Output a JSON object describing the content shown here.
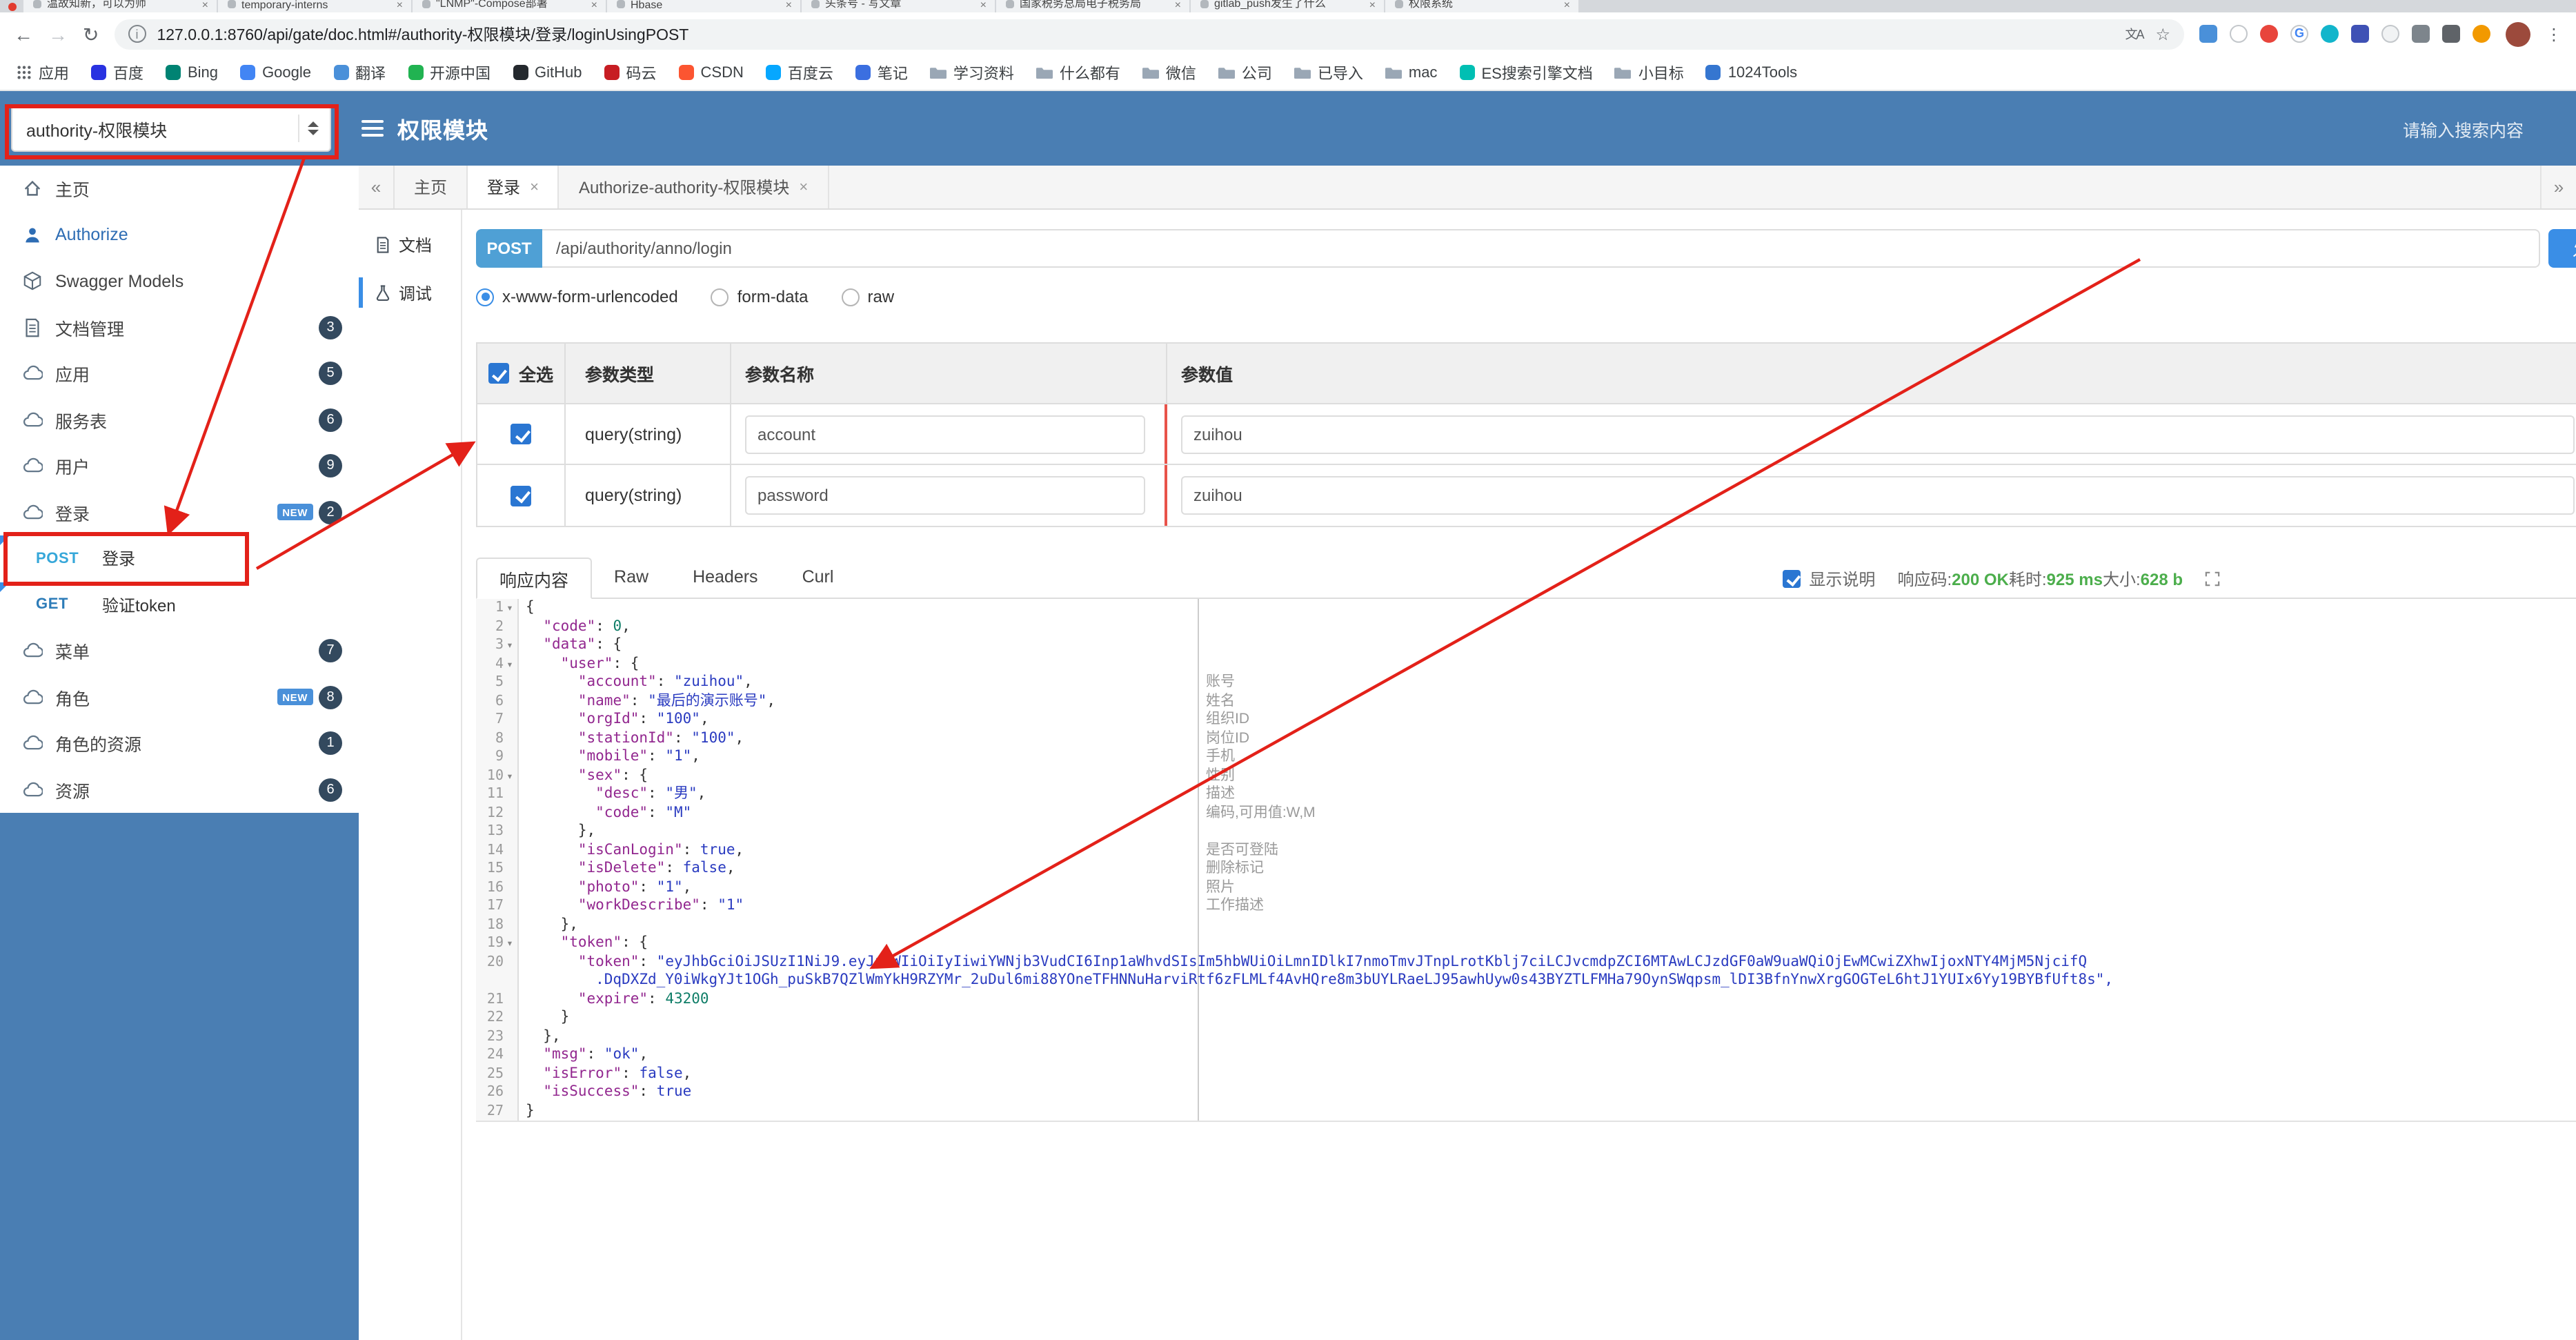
{
  "colors": {
    "header_blue": "#4a7eb3",
    "accent_blue": "#3a8ee6",
    "post_badge_blue": "#4fa0d5",
    "annotation_red": "#e32119",
    "success_green": "#4cae4c",
    "badge_navy": "#33495e"
  },
  "browser": {
    "tabs": [
      "温故知新，可以为师",
      "temporary-interns",
      "\"LNMP\"-Compose部署",
      "Hbase",
      "头条号 - 写文章",
      "国家税务总局电子税务局",
      "gitlab_push发生了什么",
      "权限系统"
    ],
    "url": "127.0.0.1:8760/api/gate/doc.html#/authority-权限模块/登录/loginUsingPOST",
    "extensions": [
      {
        "color": "#4a90d9"
      },
      {
        "color": "#ffffff",
        "round": true,
        "ring": true
      },
      {
        "color": "#e8453c",
        "round": true
      },
      {
        "letter": "G",
        "color": "#ffffff",
        "round": true,
        "ring": true
      },
      {
        "color": "#12b5cb",
        "round": true
      },
      {
        "color": "#3f51b5"
      },
      {
        "color": "#f1f3f4",
        "round": true,
        "ring": true
      },
      {
        "color": "#7d858c"
      },
      {
        "color": "#5f6368"
      },
      {
        "color": "#f29900",
        "round": true
      }
    ],
    "bookmarks": [
      {
        "label": "应用",
        "apps": true
      },
      {
        "label": "百度",
        "color": "#2932e1"
      },
      {
        "label": "Bing",
        "color": "#008373"
      },
      {
        "label": "Google",
        "color": "#4285f4"
      },
      {
        "label": "翻译",
        "color": "#4a90d9"
      },
      {
        "label": "开源中国",
        "color": "#21b351"
      },
      {
        "label": "GitHub",
        "color": "#24292e"
      },
      {
        "label": "码云",
        "color": "#c71d23"
      },
      {
        "label": "CSDN",
        "color": "#fc5531"
      },
      {
        "label": "百度云",
        "color": "#06a7ff"
      },
      {
        "label": "笔记",
        "color": "#3b6fe0"
      },
      {
        "label": "学习资料",
        "folder": true
      },
      {
        "label": "什么都有",
        "folder": true
      },
      {
        "label": "微信",
        "folder": true
      },
      {
        "label": "公司",
        "folder": true
      },
      {
        "label": "已导入",
        "folder": true
      },
      {
        "label": "mac",
        "folder": true
      },
      {
        "label": "ES搜索引擎文档",
        "color": "#00bfb3"
      },
      {
        "label": "小目标",
        "folder": true
      },
      {
        "label": "1024Tools",
        "color": "#3576d0"
      }
    ]
  },
  "header": {
    "module_select": "authority-权限模块",
    "title": "权限模块",
    "search_placeholder": "请输入搜索内容"
  },
  "sidebar": {
    "new_label": "NEW",
    "items": [
      {
        "label": "主页"
      },
      {
        "label": "Authorize"
      },
      {
        "label": "Swagger Models"
      },
      {
        "label": "文档管理",
        "badge": "3"
      },
      {
        "label": "应用",
        "badge": "5"
      },
      {
        "label": "服务表",
        "badge": "6"
      },
      {
        "label": "用户",
        "badge": "9"
      },
      {
        "label": "登录",
        "badge": "2",
        "new": true
      },
      {
        "method": "POST",
        "label": "登录"
      },
      {
        "method": "GET",
        "label": "验证token"
      },
      {
        "label": "菜单",
        "badge": "7"
      },
      {
        "label": "角色",
        "badge": "8",
        "new": true
      },
      {
        "label": "角色的资源",
        "badge": "1"
      },
      {
        "label": "资源",
        "badge": "6"
      }
    ]
  },
  "main": {
    "tabs": [
      {
        "label": "主页"
      },
      {
        "label": "登录"
      },
      {
        "label": "Authorize-authority-权限模块"
      }
    ],
    "doc_tabs": [
      {
        "label": "文档"
      },
      {
        "label": "调试"
      }
    ]
  },
  "request": {
    "method": "POST",
    "url": "/api/authority/anno/login",
    "send_label": "发送",
    "content_types": [
      "x-www-form-urlencoded",
      "form-data",
      "raw"
    ],
    "params": {
      "headers": {
        "all": "全选",
        "type": "参数类型",
        "name": "参数名称",
        "value": "参数值"
      },
      "rows": [
        {
          "type": "query(string)",
          "name": "account",
          "value": "zuihou",
          "checked": true
        },
        {
          "type": "query(string)",
          "name": "password",
          "value": "zuihou",
          "checked": true
        }
      ]
    }
  },
  "response": {
    "tabs": [
      "响应内容",
      "Raw",
      "Headers",
      "Curl"
    ],
    "show_desc_label": "显示说明",
    "meta": {
      "code_label": "响应码:",
      "code_value": "200 OK",
      "time_label": "耗时:",
      "time_value": "925 ms",
      "size_label": "大小:",
      "size_value": "628 b"
    },
    "code": {
      "rows": [
        {
          "n": "1",
          "fold": true,
          "t": "{"
        },
        {
          "n": "2",
          "t": "  \"code\": 0,"
        },
        {
          "n": "3",
          "fold": true,
          "t": "  \"data\": {"
        },
        {
          "n": "4",
          "fold": true,
          "t": "    \"user\": {"
        },
        {
          "n": "5",
          "t": "      \"account\": \"zuihou\","
        },
        {
          "n": "6",
          "t": "      \"name\": \"最后的演示账号\","
        },
        {
          "n": "7",
          "t": "      \"orgId\": \"100\","
        },
        {
          "n": "8",
          "t": "      \"stationId\": \"100\","
        },
        {
          "n": "9",
          "t": "      \"mobile\": \"1\","
        },
        {
          "n": "10",
          "fold": true,
          "t": "      \"sex\": {"
        },
        {
          "n": "11",
          "t": "        \"desc\": \"男\","
        },
        {
          "n": "12",
          "t": "        \"code\": \"M\""
        },
        {
          "n": "13",
          "t": "      },"
        },
        {
          "n": "14",
          "t": "      \"isCanLogin\": true,"
        },
        {
          "n": "15",
          "t": "      \"isDelete\": false,"
        },
        {
          "n": "16",
          "t": "      \"photo\": \"1\","
        },
        {
          "n": "17",
          "t": "      \"workDescribe\": \"1\""
        },
        {
          "n": "18",
          "t": "    },"
        },
        {
          "n": "19",
          "fold": true,
          "t": "    \"token\": {"
        },
        {
          "n": "20",
          "t": "      \"token\": \"eyJhbGciOiJSUzI1NiJ9.eyJzdWIiOiIyIiwiYWNjb3VudCI6Inp1aWhvdSIsIm5hbWUiOiLmnIDlkI7nmoTmvJTnpLrotKblj7ciLCJvcmdpZCI6MTAwLCJzdGF0aW9uaWQiOjEwMCwiZXhwIjoxNTY4MjM5NjcifQ"
        },
        {
          "n": "",
          "str": true,
          "t": "        .DqDXZd_Y0iWkgYJt1OGh_puSkB7QZlWmYkH9RZYMr_2uDul6mi88YOneTFHNNuHarviRtf6zFLMLf4AvHQre8m3bUYLRaeLJ95awhUyw0s43BYZTLFMHa79OynSWqpsm_lDI3BfnYnwXrgGOGTeL6htJ1YUIx6Yy19BYBfUft8s\","
        },
        {
          "n": "21",
          "t": "      \"expire\": 43200"
        },
        {
          "n": "22",
          "t": "    }"
        },
        {
          "n": "23",
          "t": "  },"
        },
        {
          "n": "24",
          "t": "  \"msg\": \"ok\","
        },
        {
          "n": "25",
          "t": "  \"isError\": false,"
        },
        {
          "n": "26",
          "t": "  \"isSuccess\": true"
        },
        {
          "n": "27",
          "t": "}"
        }
      ],
      "annotations": {
        "5": "账号",
        "6": "姓名",
        "7": "组织ID",
        "8": "岗位ID",
        "9": "手机",
        "10": "性别",
        "11": "描述",
        "12": "编码,可用值:W,M",
        "14": "是否可登陆",
        "15": "删除标记",
        "16": "照片",
        "17": "工作描述"
      }
    }
  }
}
